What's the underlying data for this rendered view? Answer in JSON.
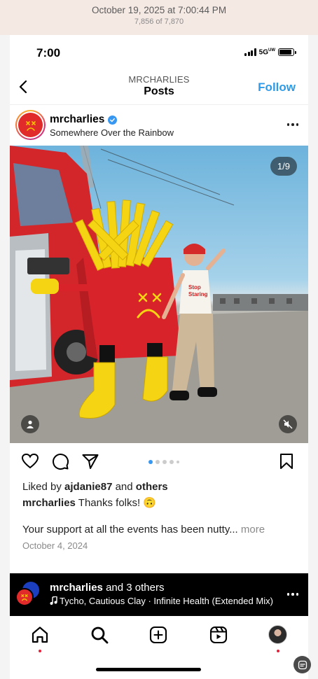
{
  "capture": {
    "date": "October 19, 2025 at 7:00:44 PM",
    "count": "7,856 of 7,870"
  },
  "status_bar": {
    "time": "7:00",
    "network": "5G",
    "network_suffix": "UW",
    "battery_level": 0.9
  },
  "nav": {
    "subtitle": "MRCHARLIES",
    "title": "Posts",
    "follow_label": "Follow"
  },
  "post": {
    "username": "mrcharlies",
    "verified": true,
    "location": "Somewhere Over the Rainbow",
    "media_counter": "1/9",
    "carousel_active_index": 0,
    "liked_by_prefix": "Liked by",
    "liked_by_user": "ajdanie87",
    "liked_by_and": "and",
    "liked_by_others": "others",
    "caption_user": "mrcharlies",
    "caption_text": "Thanks folks! 🙃",
    "caption_more_text": "Your support at all the events has been nutty...",
    "more_label": "more",
    "date": "October 4, 2024"
  },
  "music": {
    "title_user": "mrcharlies",
    "title_rest": "and 3 others",
    "track": "Tycho, Cautious Clay · Infinite Health (Extended Mix)"
  },
  "colors": {
    "accent_blue": "#2d9be8",
    "brand_red": "#e12a2a",
    "notification_red": "#e4203a"
  },
  "icons": [
    "back-icon",
    "verified-icon",
    "more-icon",
    "person-tag-icon",
    "mute-icon",
    "heart-icon",
    "comment-icon",
    "share-icon",
    "bookmark-icon",
    "music-note-icon",
    "home-icon",
    "search-icon",
    "create-icon",
    "reels-icon",
    "profile-icon"
  ]
}
